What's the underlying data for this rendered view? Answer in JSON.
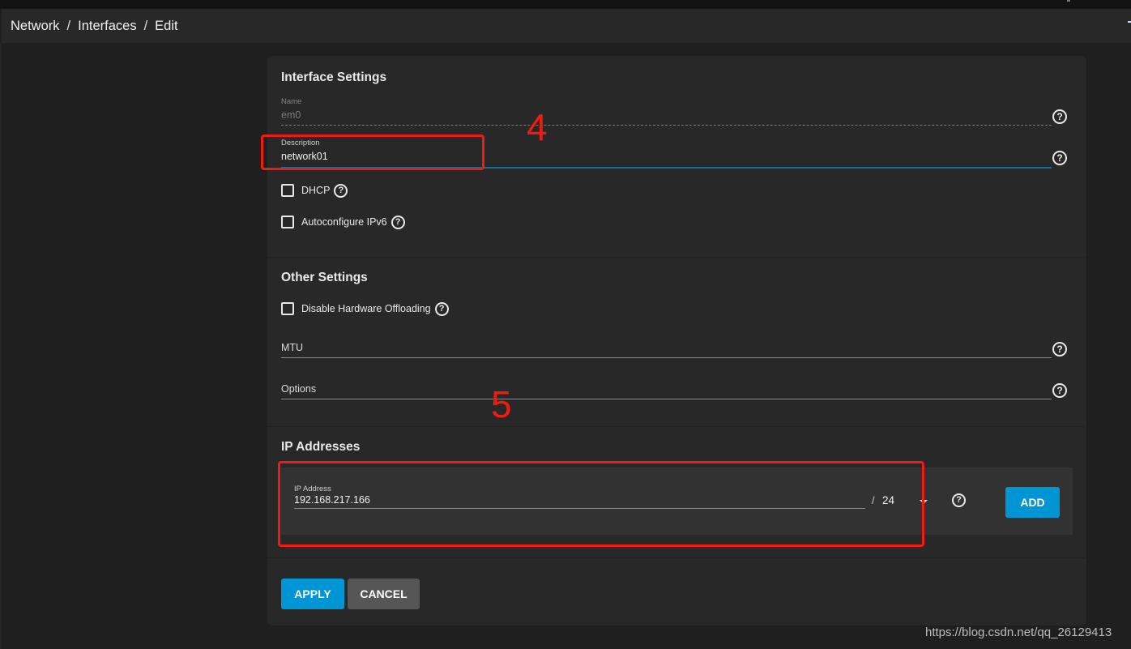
{
  "breadcrumb": [
    "Network",
    "Interfaces",
    "Edit"
  ],
  "breadcrumb_separator": "/",
  "sections": {
    "interface_settings": {
      "title": "Interface Settings",
      "name_field": {
        "label": "Name",
        "value": "em0",
        "disabled": true
      },
      "description_field": {
        "label": "Description",
        "value": "network01",
        "focused": true
      },
      "checkboxes": [
        {
          "label": "DHCP",
          "checked": false
        },
        {
          "label": "Autoconfigure IPv6",
          "checked": false
        }
      ]
    },
    "other_settings": {
      "title": "Other Settings",
      "checkboxes": [
        {
          "label": "Disable Hardware Offloading",
          "checked": false
        }
      ],
      "mtu_field": {
        "placeholder": "MTU",
        "value": ""
      },
      "options_field": {
        "placeholder": "Options",
        "value": ""
      }
    },
    "ip_addresses": {
      "title": "IP Addresses",
      "ip_field": {
        "label": "IP Address",
        "value": "192.168.217.166"
      },
      "netmask_separator": "/",
      "netmask": "24",
      "add_label": "ADD"
    }
  },
  "actions": {
    "apply_label": "APPLY",
    "cancel_label": "CANCEL"
  },
  "help_icon_glyph": "?",
  "annotations": [
    {
      "number": "4",
      "color": "#f21b12"
    },
    {
      "number": "5",
      "color": "#f21b12"
    }
  ],
  "colors": {
    "accent": "#0095d5",
    "focus_underline": "#1c6f90",
    "background": "#1f1f1f",
    "card": "#282828"
  },
  "watermark": "https://blog.csdn.net/qq_26129413"
}
